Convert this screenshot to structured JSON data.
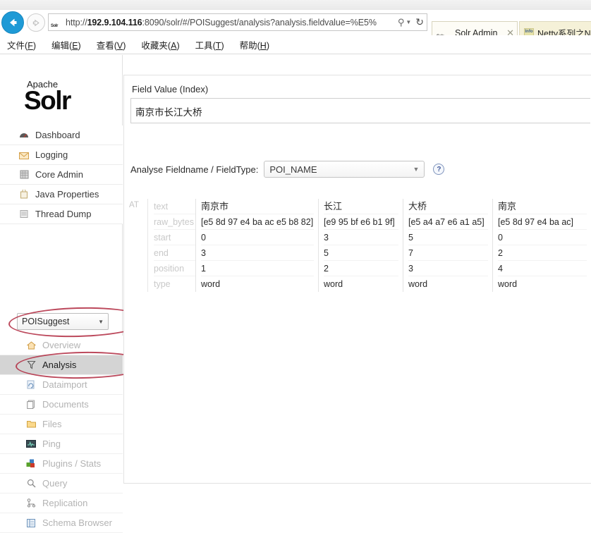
{
  "browser": {
    "back_button": "back-arrow",
    "forward_button": "forward-arrow",
    "url_host": "192.9.104.116",
    "url_prefix": "http://",
    "url_suffix": ":8090/solr/#/POISuggest/analysis?analysis.fieldvalue=%E5%",
    "url_full": "http://192.9.104.116:8090/solr/#/POISuggest/analysis?analysis.fieldvalue=%E5%",
    "search_glyph": "⚲",
    "search_caret": "▼",
    "reload_glyph": "↻",
    "tabs": [
      {
        "title": "Solr Admin",
        "close": "✕",
        "favicon": "solr-favicon",
        "active": true
      },
      {
        "title": "Netty系列之N.",
        "favicon": "info-favicon",
        "active": false
      }
    ],
    "menu": [
      {
        "label": "文件",
        "accel": "F"
      },
      {
        "label": "编辑",
        "accel": "E"
      },
      {
        "label": "查看",
        "accel": "V"
      },
      {
        "label": "收藏夹",
        "accel": "A"
      },
      {
        "label": "工具",
        "accel": "T"
      },
      {
        "label": "帮助",
        "accel": "H"
      }
    ]
  },
  "sidebar": {
    "logo": {
      "apache": "Apache",
      "solr": "Solr"
    },
    "items": [
      {
        "label": "Dashboard",
        "icon": "dashboard-icon",
        "glyph": "◑"
      },
      {
        "label": "Logging",
        "icon": "logging-icon",
        "glyph": "✉"
      },
      {
        "label": "Core Admin",
        "icon": "core-admin-icon",
        "glyph": "☷"
      },
      {
        "label": "Java Properties",
        "icon": "java-properties-icon",
        "glyph": "☕"
      },
      {
        "label": "Thread Dump",
        "icon": "thread-dump-icon",
        "glyph": "☰"
      }
    ],
    "core_selector": {
      "value": "POISuggest",
      "caret": "▼"
    },
    "core_items": [
      {
        "label": "Overview",
        "icon": "home-icon",
        "glyph": "⌂",
        "active": false
      },
      {
        "label": "Analysis",
        "icon": "funnel-icon",
        "glyph": "▽",
        "active": true
      },
      {
        "label": "Dataimport",
        "icon": "dataimport-icon",
        "glyph": "↻",
        "active": false
      },
      {
        "label": "Documents",
        "icon": "documents-icon",
        "glyph": "❐",
        "active": false
      },
      {
        "label": "Files",
        "icon": "folder-icon",
        "glyph": "▧",
        "active": false
      },
      {
        "label": "Ping",
        "icon": "ping-icon",
        "glyph": "■",
        "active": false
      },
      {
        "label": "Plugins / Stats",
        "icon": "plugins-icon",
        "glyph": "▣",
        "active": false
      },
      {
        "label": "Query",
        "icon": "magnifier-icon",
        "glyph": "⚲",
        "active": false
      },
      {
        "label": "Replication",
        "icon": "replication-icon",
        "glyph": "⚬",
        "active": false
      },
      {
        "label": "Schema Browser",
        "icon": "schema-icon",
        "glyph": "▤",
        "active": false
      }
    ]
  },
  "main": {
    "field_value_label": "Field Value (Index)",
    "field_value": "南京市长江大桥",
    "analyse_label": "Analyse Fieldname / FieldType:",
    "fieldtype_value": "POI_NAME",
    "fieldtype_caret": "▼",
    "help_icon_label": "?",
    "analysis": {
      "stage_label": "AT",
      "attributes": [
        "text",
        "raw_bytes",
        "start",
        "end",
        "position",
        "type"
      ],
      "tokens": [
        {
          "text": "南京市",
          "raw_bytes": "[e5 8d 97 e4 ba ac e5 b8 82]",
          "start": "0",
          "end": "3",
          "position": "1",
          "type": "word"
        },
        {
          "text": "长江",
          "raw_bytes": "[e9 95 bf e6 b1 9f]",
          "start": "3",
          "end": "5",
          "position": "2",
          "type": "word"
        },
        {
          "text": "大桥",
          "raw_bytes": "[e5 a4 a7 e6 a1 a5]",
          "start": "5",
          "end": "7",
          "position": "3",
          "type": "word"
        },
        {
          "text": "南京",
          "raw_bytes": "[e5 8d 97 e4 ba ac]",
          "start": "0",
          "end": "2",
          "position": "4",
          "type": "word"
        }
      ]
    }
  },
  "annotations": {
    "color": "#b0293f",
    "shapes": [
      {
        "name": "ellipse-around-core-selector"
      },
      {
        "name": "ellipse-around-analysis-menu"
      }
    ]
  }
}
